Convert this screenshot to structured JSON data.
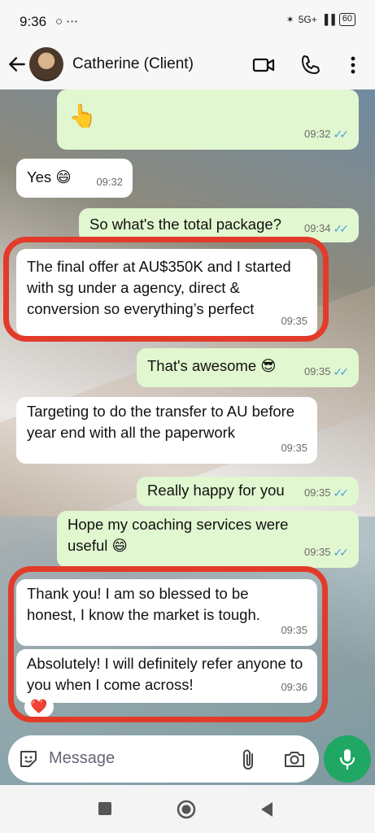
{
  "status_bar": {
    "time": "9:36",
    "left_icons": "○ ⋯",
    "network": "5G+",
    "battery": "60"
  },
  "header": {
    "contact_name": "Catherine (Client)"
  },
  "messages": [
    {
      "dir": "out",
      "text": "👆",
      "time": "09:32",
      "read": true
    },
    {
      "dir": "in",
      "text": "Yes 😄",
      "time": "09:32"
    },
    {
      "dir": "out",
      "text": "So what's the total package?",
      "time": "09:34",
      "read": true
    },
    {
      "dir": "in",
      "text": "The final offer at AU$350K and I started with sg under a agency, direct & conversion so everything’s perfect",
      "time": "09:35"
    },
    {
      "dir": "out",
      "text": "That's awesome 😎",
      "time": "09:35",
      "read": true
    },
    {
      "dir": "in",
      "text": "Targeting to do the transfer to AU before year end with all the paperwork",
      "time": "09:35"
    },
    {
      "dir": "out",
      "text": "Really happy for you",
      "time": "09:35",
      "read": true
    },
    {
      "dir": "out",
      "text": "Hope my coaching services were useful 😄",
      "time": "09:35",
      "read": true
    },
    {
      "dir": "in",
      "text": "Thank you! I am so blessed to be honest, I know the market is tough.",
      "time": "09:35"
    },
    {
      "dir": "in",
      "text": "Absolutely! I will definitely refer anyone to you when I come across!",
      "time": "09:36"
    }
  ],
  "reaction": "❤️",
  "input": {
    "placeholder": "Message"
  },
  "colors": {
    "accent_green": "#21a764",
    "outgoing_bubble": "#e1f7cf",
    "highlight_red": "#e23b2a",
    "read_tick": "#4aa3df"
  }
}
